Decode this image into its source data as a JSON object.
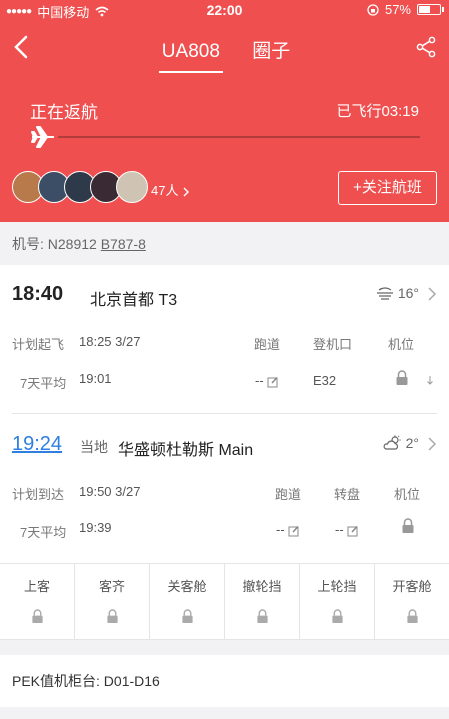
{
  "status_bar": {
    "carrier": "中国移动",
    "time": "22:00",
    "battery": "57%",
    "battery_level": 0.57
  },
  "nav": {
    "tabs": [
      {
        "label": "UA808",
        "active": true
      },
      {
        "label": "圈子",
        "active": false
      }
    ]
  },
  "flight_status": {
    "state": "正在返航",
    "elapsed": "已飞行03:19"
  },
  "followers": {
    "count_label": "47人",
    "follow_button": "+关注航班"
  },
  "aircraft": {
    "label": "机号:",
    "registration": "N28912",
    "model": "B787-8"
  },
  "departure": {
    "time": "18:40",
    "airport": "北京首都 T3",
    "temp": "16°",
    "columns": [
      "跑道",
      "登机口",
      "机位"
    ],
    "planned_label": "计划起飞",
    "planned_value": "18:25 3/27",
    "avg_label": "7天平均",
    "avg_value": "19:01",
    "runway": "--",
    "gate": "E32"
  },
  "arrival": {
    "time": "19:24",
    "local_label": "当地",
    "airport": "华盛顿杜勒斯 Main",
    "temp": "2°",
    "columns": [
      "跑道",
      "转盘",
      "机位"
    ],
    "planned_label": "计划到达",
    "planned_value": "19:50 3/27",
    "avg_label": "7天平均",
    "avg_value": "19:39",
    "runway": "--",
    "carousel": "--"
  },
  "stages": [
    "上客",
    "客齐",
    "关客舱",
    "撤轮挡",
    "上轮挡",
    "开客舱"
  ],
  "checkin": {
    "label": "PEK值机柜台:",
    "value": "D01-D16"
  },
  "colors": {
    "header_red": "#ef4f4f",
    "link_blue": "#2f7fe0"
  }
}
